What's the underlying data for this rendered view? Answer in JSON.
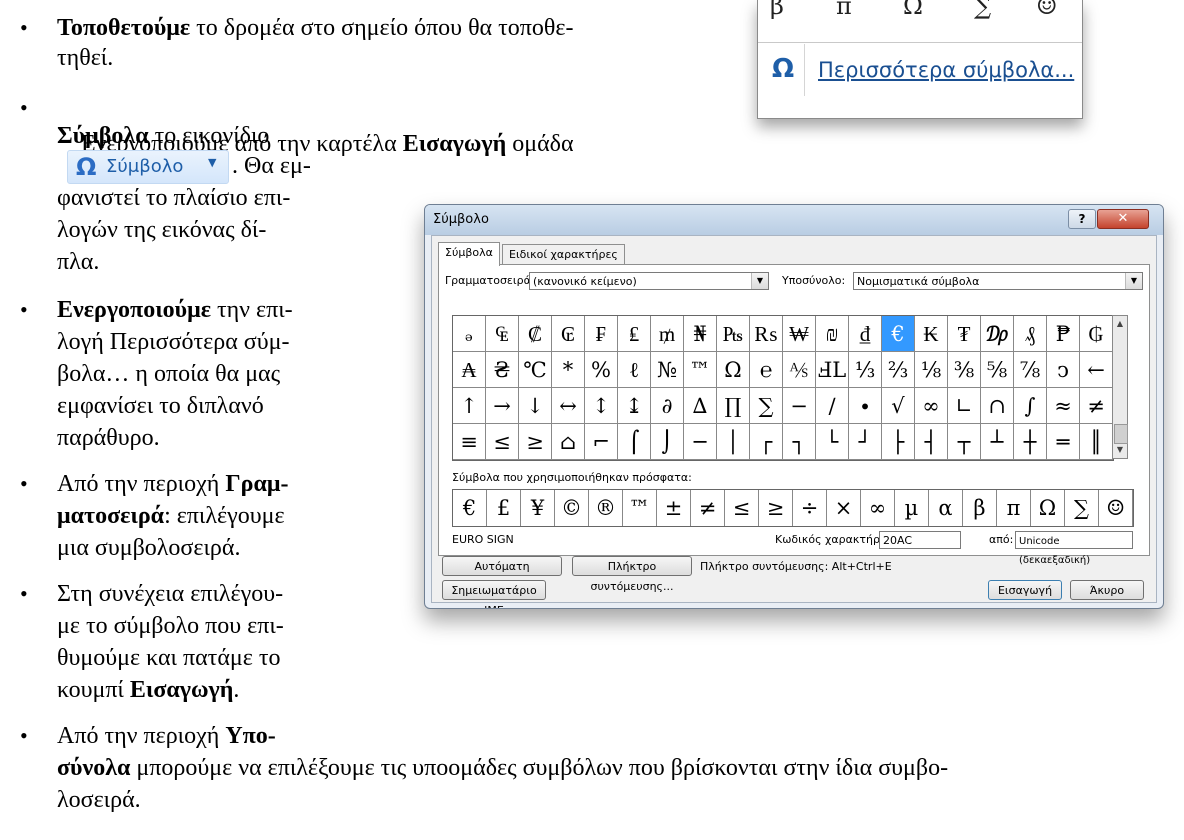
{
  "document": {
    "p1_bold": "Τοποθετούμε",
    "p1_rest": " το δρομέα στο σημείο όπου θα τοποθε-",
    "p1_line2": "τηθεί.",
    "p2_line1_a": "Ενεργοποιούμε από την καρτέλα ",
    "p2_line1_b": "Εισαγωγή",
    "p2_line1_c": " ομάδα",
    "p2_line2_a": "Σύμβολα",
    "p2_line2_b": " το εικονίδιο",
    "p2_after_button": ". Θα εμ-",
    "p2_line4": "φανιστεί το πλαίσιο επι-",
    "p2_line5": "λογών της εικόνας δί-",
    "p2_line6": "πλα.",
    "p3_line1_a": "Ενεργοποιούμε",
    "p3_line1_b": " την επι-",
    "p3_line2": "λογή Περισσότερα σύμ-",
    "p3_line3": "βολα… η οποία θα μας",
    "p3_line4": "εμφανίσει το διπλανό",
    "p3_line5": "παράθυρο.",
    "p4_line1_a": "Από την περιοχή ",
    "p4_line1_b": "Γραμ-",
    "p4_line2_a": "ματοσειρά",
    "p4_line2_b": ": επιλέγουμε",
    "p4_line3": "μια συμβολοσειρά.",
    "p5_line1": "Στη συνέχεια επιλέγου-",
    "p5_line2": "με το σύμβολο που επι-",
    "p5_line3": "θυμούμε και πατάμε το",
    "p5_line4_a": "κουμπί ",
    "p5_line4_b": "Εισαγωγή",
    "p5_line4_c": ".",
    "p6_line1_a": "Από την περιοχή ",
    "p6_line1_b": "Υπο-",
    "p6_line2_a": "σύνολα",
    "p6_line2_b": " μπορούμε να επιλέξουμε τις υποομάδες συμβόλων που βρίσκονται στην ίδια συμβο-",
    "p6_line3": "λοσειρά.",
    "bullet_char": "•"
  },
  "ribbon_button": {
    "icon": "Ω",
    "label": "Σύμβολο",
    "caret": "▼",
    "icon_name": "omega-icon"
  },
  "symbols_dropdown": {
    "symbols": [
      "β",
      "π",
      "Ω",
      "∑",
      "☺"
    ],
    "more_icon": "Ω",
    "more_label": "Περισσότερα σύμβολα..."
  },
  "dialog": {
    "title": "Σύμβολο",
    "help": "?",
    "close": "✕",
    "tabs": [
      "Σύμβολα",
      "Ειδικοί χαρακτήρες"
    ],
    "font_label": "Γραμματοσειρά:",
    "font_value": "(κανονικό κείμενο)",
    "subset_label": "Υποσύνολο:",
    "subset_value": "Νομισματικά σύμβολα",
    "grid_rows": [
      [
        "ₔ",
        "₠",
        "₡",
        "₢",
        "₣",
        "₤",
        "₥",
        "₦",
        "₧",
        "₨",
        "₩",
        "₪",
        "₫",
        "€",
        "₭",
        "₮",
        "₯",
        "₰",
        "₱",
        "₲"
      ],
      [
        "₳",
        "₴",
        "℃",
        "*",
        "%",
        "ℓ",
        "№",
        "™",
        "Ω",
        "℮",
        "⅍",
        "ℲL",
        "⅓",
        "⅔",
        "⅛",
        "⅜",
        "⅝",
        "⅞",
        "ↄ",
        "←"
      ],
      [
        "↑",
        "→",
        "↓",
        "↔",
        "↕",
        "↨",
        "∂",
        "∆",
        "∏",
        "∑",
        "−",
        "∕",
        "∙",
        "√",
        "∞",
        "∟",
        "∩",
        "∫",
        "≈",
        "≠"
      ],
      [
        "≡",
        "≤",
        "≥",
        "⌂",
        "⌐",
        "⌠",
        "⌡",
        "─",
        "│",
        "┌",
        "┐",
        "└",
        "┘",
        "├",
        "┤",
        "┬",
        "┴",
        "┼",
        "═",
        "║"
      ]
    ],
    "selected_cell": "0-13",
    "recent_label": "Σύμβολα που χρησιμοποιήθηκαν πρόσφατα:",
    "recent": [
      "€",
      "£",
      "¥",
      "©",
      "®",
      "™",
      "±",
      "≠",
      "≤",
      "≥",
      "÷",
      "×",
      "∞",
      "µ",
      "α",
      "β",
      "π",
      "Ω",
      "∑",
      "☺"
    ],
    "char_name": "EURO SIGN",
    "code_label": "Κωδικός χαρακτήρα:",
    "code_value": "20AC",
    "from_label": "από:",
    "from_value": "Unicode (δεκαεξαδική)",
    "autocorrect_btn": "Αυτόματη Διόρθωση...",
    "shortcut_btn": "Πλήκτρο συντόμευσης...",
    "shortcut_text": "Πλήκτρο συντόμευσης: Alt+Ctrl+E",
    "ime_btn": "Σημειωματάριο IME",
    "insert_btn": "Εισαγωγή",
    "cancel_btn": "Άκυρο"
  }
}
